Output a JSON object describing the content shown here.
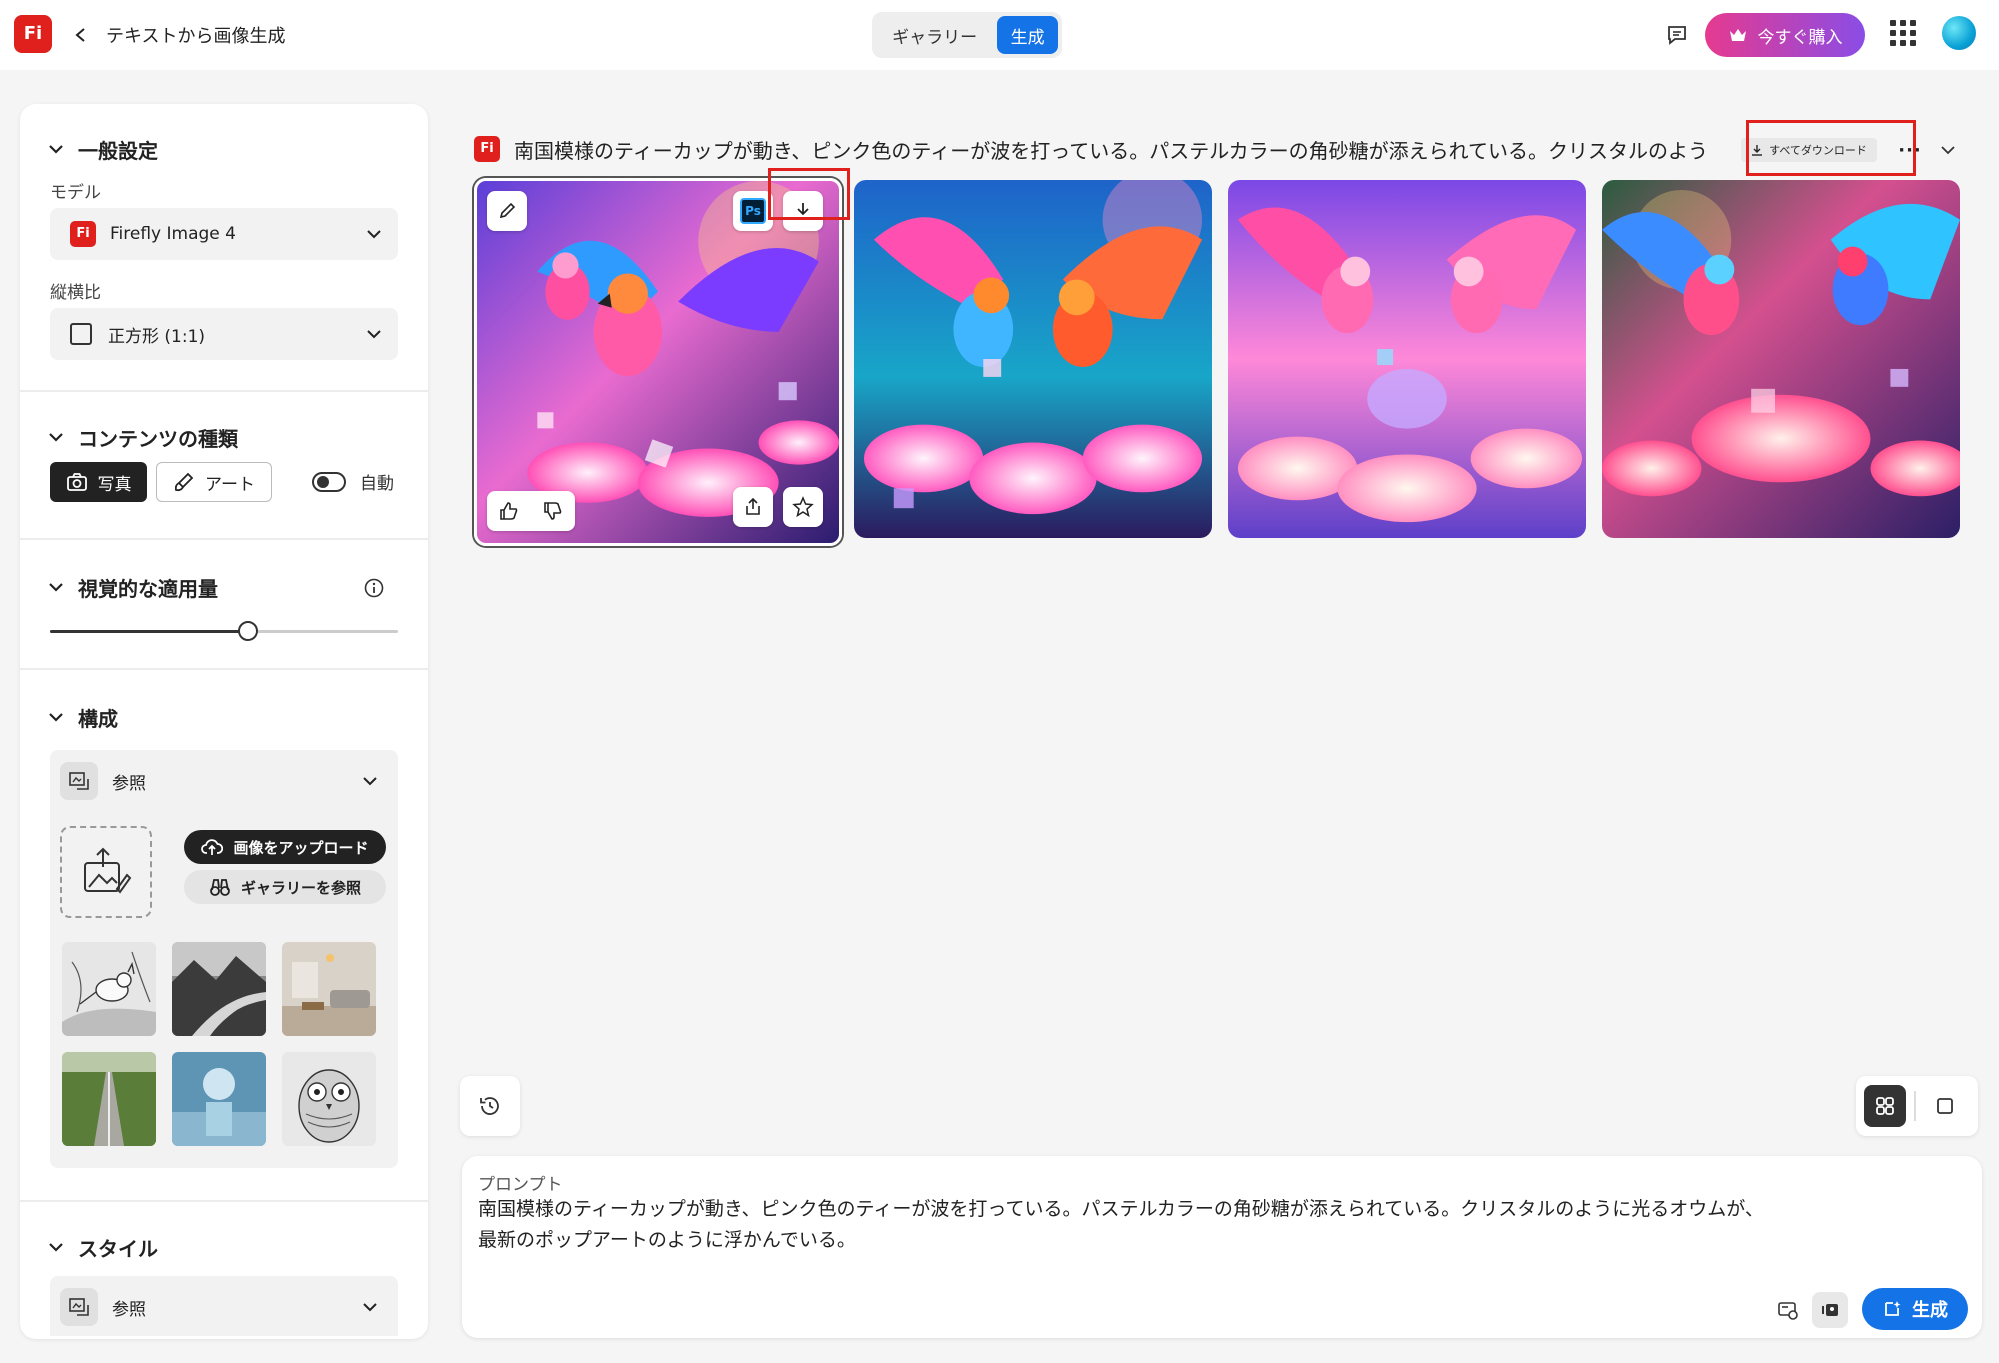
{
  "app": {
    "logo_text": "Fi",
    "page_title": "テキストから画像生成",
    "brand_color": "#e0201c",
    "accent_color": "#1473e6"
  },
  "header": {
    "mode_tabs": [
      {
        "label": "ギャラリー",
        "active": false
      },
      {
        "label": "生成",
        "active": true
      }
    ],
    "buy_label": "今すぐ購入",
    "icons": [
      "chevron-left-icon",
      "chat-icon",
      "crown-icon",
      "app-grid-icon",
      "avatar"
    ]
  },
  "sidebar": {
    "general": {
      "title": "一般設定",
      "model_label": "モデル",
      "model_value": "Firefly Image 4",
      "aspect_label": "縦横比",
      "aspect_value": "正方形 (1:1)"
    },
    "content_type": {
      "title": "コンテンツの種類",
      "options": [
        {
          "label": "写真",
          "selected": true,
          "icon": "camera-icon"
        },
        {
          "label": "アート",
          "selected": false,
          "icon": "brush-icon"
        }
      ],
      "auto_label": "自動",
      "auto_on": true
    },
    "visual_intensity": {
      "title": "視覚的な適用量",
      "value_fraction": 0.57
    },
    "composition": {
      "title": "構成",
      "ref_label": "参照",
      "upload_label": "画像をアップロード",
      "browse_label": "ギャラリーを参照",
      "thumbnails": [
        "bird-sketch",
        "mountain-river",
        "living-room",
        "field-road",
        "sphere-pedestal",
        "owl-sketch"
      ]
    },
    "style": {
      "title": "スタイル",
      "ref_label": "参照"
    }
  },
  "results": {
    "prompt_title": "南国模様のティーカップが動き、ピンク色のティーが波を打っている。パステルカラーの角砂糖が添えられている。クリスタルのよう",
    "download_all_label": "すべてダウンロード",
    "more_label": "···",
    "images": [
      "parrots-teacups-1",
      "parrots-teacups-2",
      "parrots-teacups-3",
      "parrots-teacups-4"
    ],
    "selected_index": 0,
    "ps_label": "Ps"
  },
  "prompt_box": {
    "label": "プロンプト",
    "line1": "南国模様のティーカップが動き、ピンク色のティーが波を打っている。パステルカラーの角砂糖が添えられている。クリスタルのように光るオウムが、",
    "line2": "最新のポップアートのように浮かんでいる。",
    "generate_label": "生成"
  }
}
